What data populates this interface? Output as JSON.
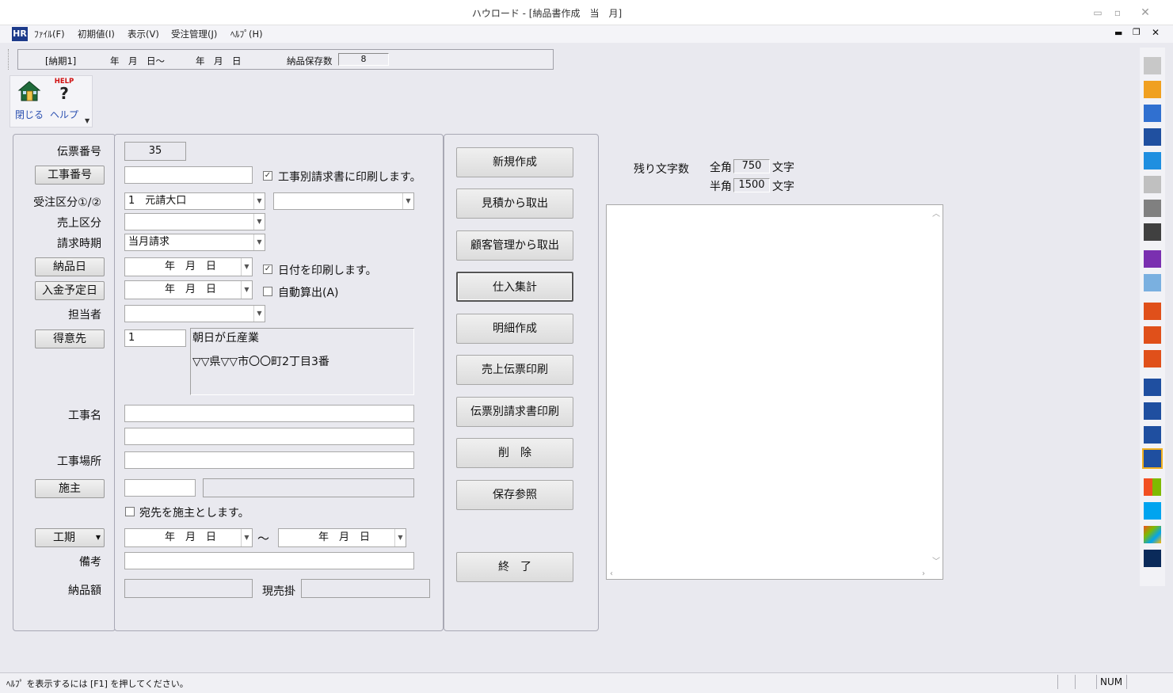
{
  "window": {
    "title": "ハウロード - [納品書作成　当　月]",
    "min_glyph": "▭",
    "max_glyph": "▫",
    "close_glyph": "✕",
    "mdi_min_glyph": "▬",
    "mdi_restore_glyph": "❐",
    "mdi_close_glyph": "✕"
  },
  "menu": {
    "logo": "HR",
    "items": [
      "ﾌｧｲﾙ(F)",
      "初期値(I)",
      "表示(V)",
      "受注管理(J)",
      "ﾍﾙﾌﾟ(H)"
    ]
  },
  "infobar": {
    "period_label": "[納期1]",
    "date_from": "年　月　日〜",
    "date_to": "年　月　日",
    "save_count_label": "納品保存数",
    "save_count_value": "8"
  },
  "toolbar": {
    "close_label": "閉じる",
    "help_label": "ヘルプ",
    "help_caption": "HELP"
  },
  "form": {
    "slip_no_label": "伝票番号",
    "slip_no_value": "35",
    "job_no_button": "工事番号",
    "job_no_value": "",
    "print_by_job_label": "工事別請求書に印刷します。",
    "print_by_job_checked": "✓",
    "order_class_label": "受注区分①/②",
    "order_class_1": "1　元請大口",
    "order_class_2": "",
    "sales_class_label": "売上区分",
    "sales_class_value": "",
    "billing_time_label": "請求時期",
    "billing_time_value": "当月請求",
    "delivery_date_button": "納品日",
    "delivery_date_value": "年　月　日",
    "print_date_label": "日付を印刷します。",
    "print_date_checked": "✓",
    "payment_date_button": "入金予定日",
    "payment_date_value": "年　月　日",
    "auto_calc_label": "自動算出(A)",
    "person_label": "担当者",
    "person_value": "",
    "customer_button": "得意先",
    "customer_code": "1",
    "customer_name": "朝日が丘産業",
    "customer_address": "▽▽県▽▽市〇〇町2丁目3番",
    "job_name_label": "工事名",
    "job_name_1": "",
    "job_name_2": "",
    "job_site_label": "工事場所",
    "job_site_value": "",
    "owner_button": "施主",
    "owner_code": "",
    "addressee_owner_label": "宛先を施主とします。",
    "period_button": "工期",
    "period_from": "年　月　日",
    "period_tilde": "〜",
    "period_to": "年　月　日",
    "remarks_label": "備考",
    "remarks_value": "",
    "amount_label": "納品額",
    "cash_credit_label": "現売掛"
  },
  "actions": {
    "new": "新規作成",
    "from_estimate": "見積から取出",
    "from_customer": "顧客管理から取出",
    "purchase_total": "仕入集計",
    "detail": "明細作成",
    "print_sales_slip": "売上伝票印刷",
    "print_invoice_by_slip": "伝票別請求書印刷",
    "delete": "削　除",
    "saved_ref": "保存参照",
    "exit": "終　了"
  },
  "remarks_panel": {
    "remaining_label": "残り文字数",
    "fullwidth_label": "全角",
    "fullwidth_value": "750",
    "halfwidth_label": "半角",
    "halfwidth_value": "1500",
    "unit": "文字"
  },
  "status": {
    "help_text": "ﾍﾙﾌﾟ を表示するには [F1] を押してください。",
    "num": "NUM"
  },
  "colors": {
    "window_bg": "#e9e9ef",
    "accent_blue": "#2a4fb0"
  }
}
